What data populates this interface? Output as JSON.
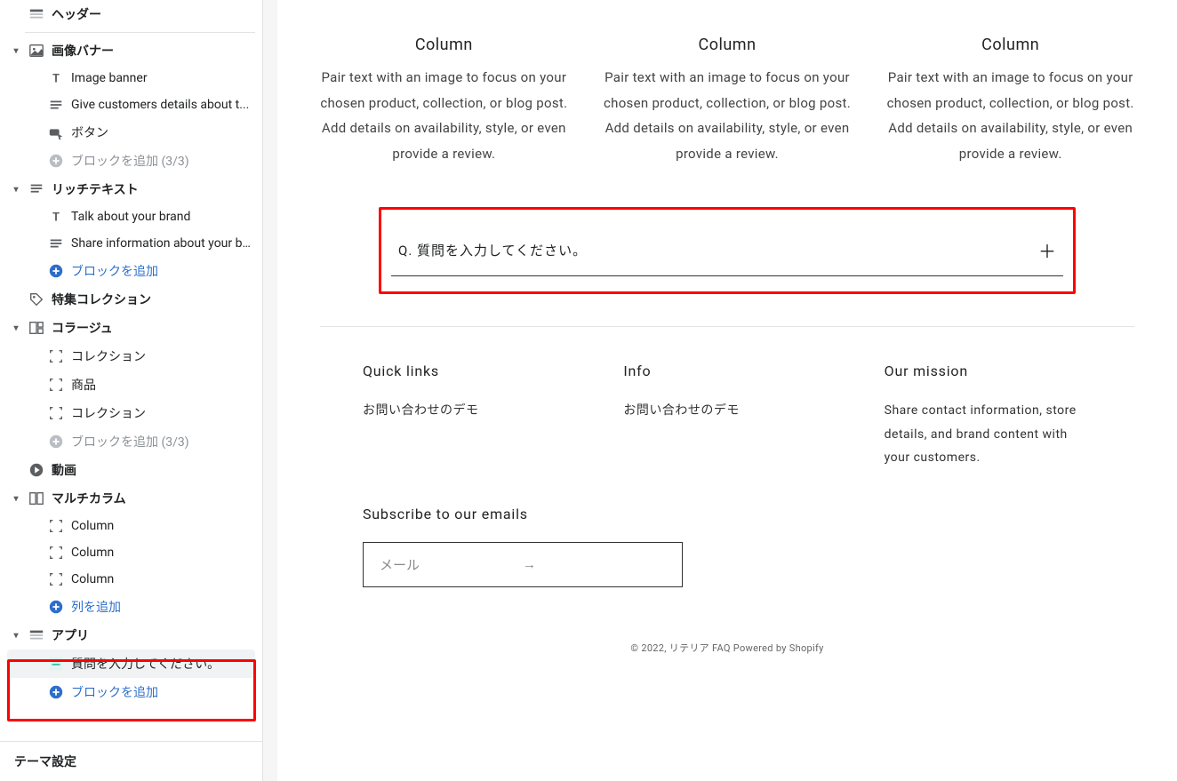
{
  "sidebar": {
    "header": "ヘッダー",
    "imageBanner": {
      "label": "画像バナー",
      "items": [
        "Image banner",
        "Give customers details about t...",
        "ボタン"
      ],
      "addBlock": "ブロックを追加 (3/3)"
    },
    "richText": {
      "label": "リッチテキスト",
      "items": [
        "Talk about your brand",
        "Share information about your b..."
      ],
      "addBlock": "ブロックを追加"
    },
    "featured": "特集コレクション",
    "collage": {
      "label": "コラージュ",
      "items": [
        "コレクション",
        "商品",
        "コレクション"
      ],
      "addBlock": "ブロックを追加 (3/3)"
    },
    "video": "動画",
    "multicolumn": {
      "label": "マルチカラム",
      "items": [
        "Column",
        "Column",
        "Column"
      ],
      "addBlock": "列を追加"
    },
    "apps": {
      "label": "アプリ",
      "items": [
        "質問を入力してください。"
      ],
      "addBlock": "ブロックを追加"
    },
    "themeSettings": "テーマ設定"
  },
  "preview": {
    "columns": [
      {
        "title": "Column",
        "text": "Pair text with an image to focus on your chosen product, collection, or blog post. Add details on availability, style, or even provide a review."
      },
      {
        "title": "Column",
        "text": "Pair text with an image to focus on your chosen product, collection, or blog post. Add details on availability, style, or even provide a review."
      },
      {
        "title": "Column",
        "text": "Pair text with an image to focus on your chosen product, collection, or blog post. Add details on availability, style, or even provide a review."
      }
    ],
    "faq": {
      "question": "Q. 質問を入力してください。"
    },
    "footer": {
      "quickLinks": {
        "title": "Quick links",
        "link": "お問い合わせのデモ"
      },
      "info": {
        "title": "Info",
        "link": "お問い合わせのデモ"
      },
      "mission": {
        "title": "Our mission",
        "text": "Share contact information, store details, and brand content with your customers."
      },
      "subscribe": {
        "title": "Subscribe to our emails",
        "placeholder": "メール"
      },
      "copyright": {
        "year": "© 2022, ",
        "store": "リテリア FAQ",
        "powered": " Powered by Shopify"
      }
    }
  }
}
